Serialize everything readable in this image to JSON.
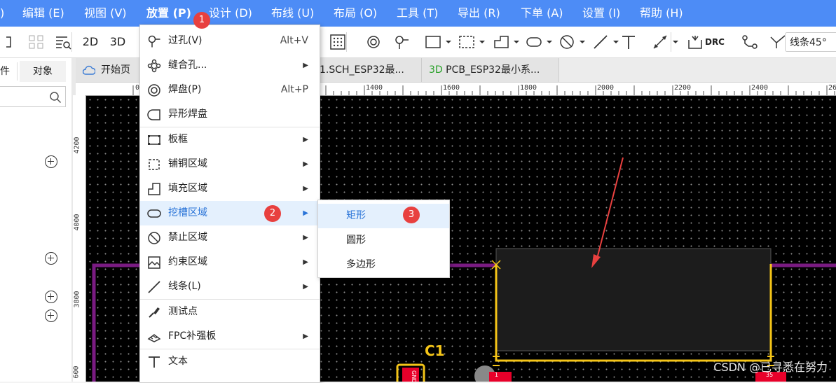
{
  "menubar": {
    "items": [
      {
        "label": ")"
      },
      {
        "label": "编辑 (E)"
      },
      {
        "label": "视图 (V)"
      },
      {
        "label": "放置 (P)"
      },
      {
        "label": "设计 (D)"
      },
      {
        "label": "布线 (U)"
      },
      {
        "label": "布局 (O)"
      },
      {
        "label": "工具 (T)"
      },
      {
        "label": "导出 (R)"
      },
      {
        "label": "下单 (A)"
      },
      {
        "label": "设置 (I)"
      },
      {
        "label": "帮助 (H)"
      }
    ]
  },
  "badges": {
    "one": "1",
    "two": "2",
    "three": "3"
  },
  "toolbar": {
    "label_2d": "2D",
    "label_3d": "3D",
    "drc": "DRC",
    "line_angle": "线条45°"
  },
  "left_panel": {
    "tab_left": "件",
    "tab_objects": "对象"
  },
  "doc_tabs": {
    "home": "开始页",
    "sch": "1.SCH_ESP32最...",
    "pcb_prefix": "3D",
    "pcb": "PCB_ESP32最小系..."
  },
  "ruler": {
    "top": [
      "1400",
      "1600",
      "1800",
      "2000",
      "2200",
      "2400",
      "26"
    ],
    "left": [
      "4200",
      "4000",
      "3800",
      "600"
    ]
  },
  "dropdown": {
    "items": [
      {
        "label": "过孔(V)",
        "shortcut": "Alt+V",
        "icon": "via-icon"
      },
      {
        "label": "缝合孔...",
        "icon": "stitch-via-icon",
        "submenu": true
      },
      {
        "label": "焊盘(P)",
        "shortcut": "Alt+P",
        "icon": "pad-icon"
      },
      {
        "label": "异形焊盘",
        "icon": "custom-pad-icon"
      },
      {
        "label": "板框",
        "icon": "board-outline-icon",
        "submenu": true
      },
      {
        "label": "铺铜区域",
        "icon": "copper-pour-icon",
        "submenu": true
      },
      {
        "label": "填充区域",
        "icon": "fill-region-icon",
        "submenu": true
      },
      {
        "label": "挖槽区域",
        "icon": "slot-region-icon",
        "submenu": true
      },
      {
        "label": "禁止区域",
        "icon": "keepout-icon",
        "submenu": true
      },
      {
        "label": "约束区域",
        "icon": "constraint-icon",
        "submenu": true
      },
      {
        "label": "线条(L)",
        "icon": "line-icon",
        "submenu": true
      },
      {
        "label": "测试点",
        "icon": "test-point-icon"
      },
      {
        "label": "FPC补强板",
        "icon": "fpc-stiffener-icon",
        "submenu": true
      },
      {
        "label": "文本",
        "icon": "text-icon"
      }
    ]
  },
  "submenu": {
    "items": [
      {
        "label": "矩形"
      },
      {
        "label": "圆形"
      },
      {
        "label": "多边形"
      }
    ]
  },
  "canvas": {
    "designator": "C1",
    "pin_label": "GND",
    "pin_number": "1",
    "pin_number_right": "35"
  },
  "watermark": "CSDN @已寻悉在努力",
  "colors": {
    "menubar": "#4d8cf6",
    "badge": "#e8403f",
    "highlight": "#e4f0fd",
    "board_outline": "#7a1b82",
    "silk": "#f5c518",
    "pad": "#e8002a",
    "arrow": "#e8403f"
  }
}
